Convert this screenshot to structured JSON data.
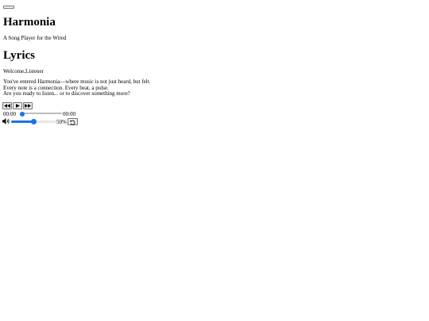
{
  "header": {
    "title": "Harmonia",
    "subtitle": "A Song Player for the Wired"
  },
  "lyrics": {
    "heading": "Lyrics",
    "welcome_prefix": "Welcome,",
    "welcome_name": "Listener",
    "lines": [
      "You've entered Harmonia—where music is not just heard, but felt.",
      "Every note is a connection. Every beat, a pulse.",
      "Are you ready to listen... or to discover something more?"
    ]
  },
  "player": {
    "current_time": "00:00",
    "duration": "00:00",
    "progress_fraction": 0,
    "volume_fraction": 0.5,
    "volume_label": "50%",
    "icons": {
      "menu": "menu-icon",
      "rewind": "rewind-icon",
      "play": "play-icon",
      "fast_forward": "fast-forward-icon",
      "volume": "speaker-icon",
      "loop": "loop-icon"
    },
    "accent_color": "#1a73e8"
  }
}
